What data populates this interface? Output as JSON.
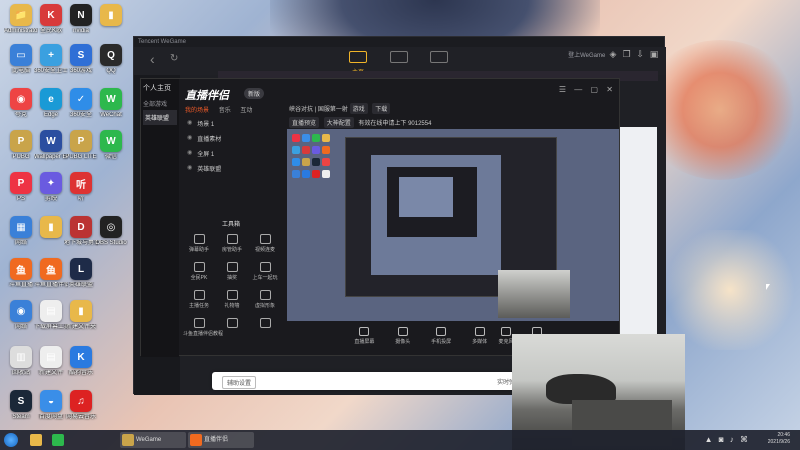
{
  "desktop": {
    "icons": [
      {
        "label": "Administrator",
        "color": "#e8b84a",
        "glyph": "📁"
      },
      {
        "label": "全民K歌",
        "color": "#d83a3a",
        "glyph": "K"
      },
      {
        "label": "nvidia",
        "color": "#222",
        "glyph": "N"
      },
      {
        "label": "",
        "color": "#e8b84a",
        "glyph": "▮"
      },
      {
        "label": "此电脑",
        "color": "#3a80d8",
        "glyph": "▭"
      },
      {
        "label": "360安全卫士",
        "color": "#3aa0e0",
        "glyph": "+"
      },
      {
        "label": "360游戏",
        "color": "#2f6fd6",
        "glyph": "S"
      },
      {
        "label": "QQ",
        "color": "#2a2a2a",
        "glyph": "Q"
      },
      {
        "label": "夸克",
        "color": "#e44",
        "glyph": "◉"
      },
      {
        "label": "Edge",
        "color": "#1a9ad6",
        "glyph": "e"
      },
      {
        "label": "360安全",
        "color": "#2f8de8",
        "glyph": "✓"
      },
      {
        "label": "WeChat",
        "color": "#2db84d",
        "glyph": "W"
      },
      {
        "label": "PUBG",
        "color": "#c9a44a",
        "glyph": "P"
      },
      {
        "label": "Wallpaper Engine",
        "color": "#2b4ea0",
        "glyph": "W"
      },
      {
        "label": "PUBG LITE",
        "color": "#c9a44a",
        "glyph": "P"
      },
      {
        "label": "微信",
        "color": "#2db84d",
        "glyph": "W"
      },
      {
        "label": "PS",
        "color": "#e34",
        "glyph": "P"
      },
      {
        "label": "剪映",
        "color": "#6a5be0",
        "glyph": "✦"
      },
      {
        "label": "听",
        "color": "#d33",
        "glyph": "听"
      },
      {
        "label": "",
        "color": "",
        "glyph": ""
      },
      {
        "label": "网络",
        "color": "#3a80d8",
        "glyph": "▦"
      },
      {
        "label": "",
        "color": "#e8b84a",
        "glyph": "▮"
      },
      {
        "label": "地下城与勇士",
        "color": "#b33",
        "glyph": "D"
      },
      {
        "label": "OBS Studio",
        "color": "#222",
        "glyph": "◎"
      },
      {
        "label": "斗鱼直播",
        "color": "#f06a20",
        "glyph": "鱼"
      },
      {
        "label": "斗鱼直播伴侣",
        "color": "#f06a20",
        "glyph": "鱼"
      },
      {
        "label": "英雄联盟",
        "color": "#1e2b48",
        "glyph": "L"
      },
      {
        "label": "",
        "color": "",
        "glyph": ""
      },
      {
        "label": "网络",
        "color": "#3a80d8",
        "glyph": "◉"
      },
      {
        "label": "下载屏幕工具",
        "color": "#eee",
        "glyph": "▤"
      },
      {
        "label": "新建文件夹",
        "color": "#e8b84a",
        "glyph": "▮"
      },
      {
        "label": "",
        "color": "",
        "glyph": ""
      },
      {
        "label": "回收站",
        "color": "#ddd",
        "glyph": "▥"
      },
      {
        "label": "新建文件",
        "color": "#eee",
        "glyph": "▤"
      },
      {
        "label": "酷狗音乐",
        "color": "#2a7ae0",
        "glyph": "K"
      },
      {
        "label": "",
        "color": "",
        "glyph": ""
      },
      {
        "label": "Steam",
        "color": "#1b2838",
        "glyph": "S"
      },
      {
        "label": "百度网盘",
        "color": "#3a8ee8",
        "glyph": "◒"
      },
      {
        "label": "网易云音乐",
        "color": "#d22",
        "glyph": "♫"
      }
    ]
  },
  "wegame": {
    "window_title": "Tencent WeGame",
    "tabs": [
      "主页",
      "",
      ""
    ],
    "active_tab_label": "主页",
    "user": "登上WeGame",
    "nav_back": "‹",
    "nav_refresh": "↻"
  },
  "broadcast": {
    "sidebar_title": "个人主页",
    "sidebar_items": [
      "全部游戏",
      "英雄联盟"
    ],
    "logo": "直播伴侣",
    "version": "新版",
    "scene_tabs": [
      "我的场景",
      "音乐",
      "互动"
    ],
    "scenes": [
      "场景 1",
      "直播素材",
      "全屏 1",
      "英雄联盟"
    ],
    "tools_title": "工具箱",
    "tools": [
      {
        "label": "弹幕助手"
      },
      {
        "label": "房管助手"
      },
      {
        "label": "视频连麦"
      },
      {
        "label": "全民PK"
      },
      {
        "label": "抽奖"
      },
      {
        "label": "上车一起玩"
      },
      {
        "label": "主播任务"
      },
      {
        "label": "礼物墙"
      },
      {
        "label": "虚拟形象"
      },
      {
        "label": "斗鱼直播伴侣教程"
      },
      {
        "label": ""
      },
      {
        "label": ""
      }
    ],
    "topbar": {
      "title": "峡谷对抗 | 国服第一射",
      "chips": [
        "游戏",
        "下载"
      ],
      "sub": [
        "直播预览",
        "大神配置",
        "有效在线申请上下",
        "9012554"
      ]
    },
    "bottom_buttons": [
      {
        "label": "直播屏幕"
      },
      {
        "label": "摄像头"
      },
      {
        "label": "手机投屏"
      },
      {
        "label": "多媒体"
      },
      {
        "label": "麦克风"
      },
      {
        "label": "扬声器"
      }
    ],
    "window_controls": [
      "☰",
      "—",
      "▢",
      "✕"
    ]
  },
  "assist_bar": {
    "button": "辅助设置",
    "text": "实时弹幕 | 电视"
  },
  "taskbar": {
    "items": [
      {
        "label": "",
        "color": "#2db84d"
      },
      {
        "label": "WeGame",
        "color": "#c9a44a"
      },
      {
        "label": "直播伴侣",
        "color": "#f06a20"
      }
    ],
    "clock_time": "20:46",
    "clock_date": "2021/9/26"
  }
}
